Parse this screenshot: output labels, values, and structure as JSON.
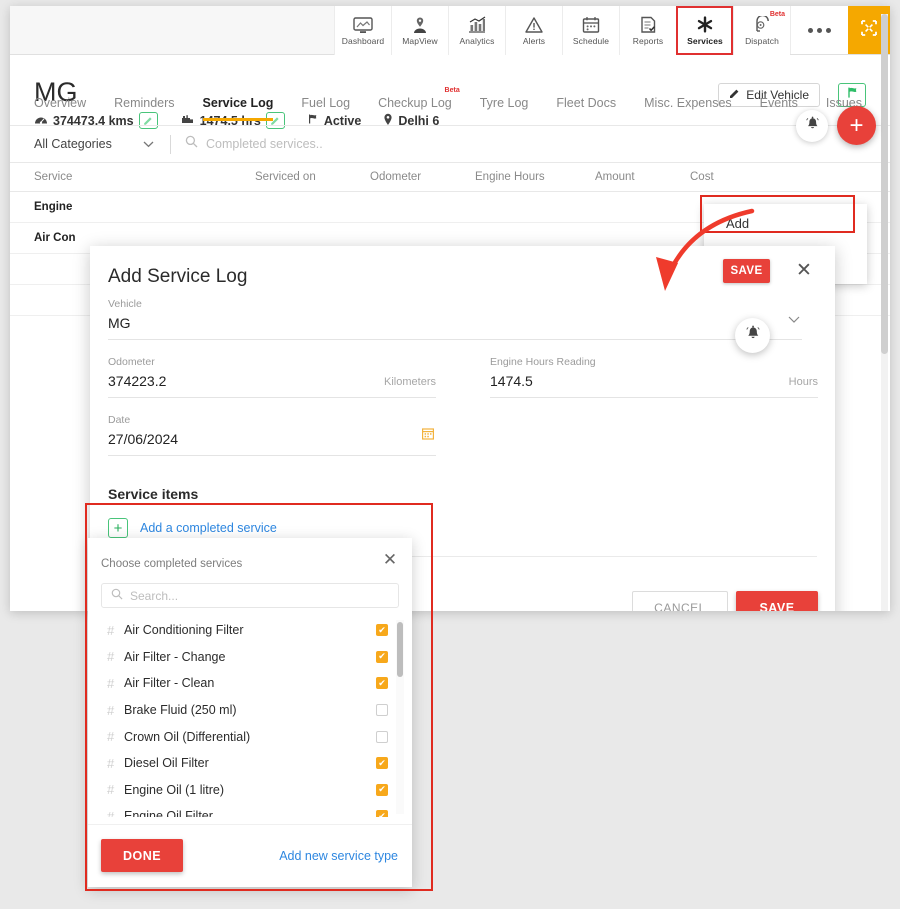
{
  "topnav": {
    "items": [
      {
        "label": "Dashboard",
        "icon": "dashboard-icon",
        "beta": "",
        "active": false
      },
      {
        "label": "MapView",
        "icon": "mapview-icon",
        "beta": "",
        "active": false
      },
      {
        "label": "Analytics",
        "icon": "analytics-icon",
        "beta": "",
        "active": false
      },
      {
        "label": "Alerts",
        "icon": "alerts-icon",
        "beta": "",
        "active": false
      },
      {
        "label": "Schedule",
        "icon": "schedule-icon",
        "beta": "",
        "active": false
      },
      {
        "label": "Reports",
        "icon": "reports-icon",
        "beta": "",
        "active": false
      },
      {
        "label": "Services",
        "icon": "services-icon",
        "beta": "",
        "active": true
      },
      {
        "label": "Dispatch",
        "icon": "dispatch-icon",
        "beta": "Beta",
        "active": false
      }
    ],
    "more_icon": "more-dots-icon",
    "collapse_icon": "collapse-fullscreen-icon"
  },
  "vehicle": {
    "name": "MG",
    "odometer": "374473.4 kms",
    "engine_hours": "1474.5 hrs",
    "status": "Active",
    "location": "Delhi 6",
    "edit_button": "Edit Vehicle",
    "flag_icon": "green-flag-icon"
  },
  "tabs": [
    {
      "label": "Overview",
      "active": false,
      "beta": ""
    },
    {
      "label": "Reminders",
      "active": false,
      "beta": ""
    },
    {
      "label": "Service Log",
      "active": true,
      "beta": ""
    },
    {
      "label": "Fuel Log",
      "active": false,
      "beta": ""
    },
    {
      "label": "Checkup Log",
      "active": false,
      "beta": "Beta"
    },
    {
      "label": "Tyre Log",
      "active": false,
      "beta": ""
    },
    {
      "label": "Fleet Docs",
      "active": false,
      "beta": ""
    },
    {
      "label": "Misc. Expenses",
      "active": false,
      "beta": ""
    },
    {
      "label": "Events",
      "active": false,
      "beta": ""
    },
    {
      "label": "Issues",
      "active": false,
      "beta": ""
    }
  ],
  "filterbar": {
    "category_value": "All Categories",
    "search_placeholder": "Completed services.."
  },
  "table": {
    "columns": [
      "Service",
      "Serviced on",
      "Odometer",
      "Engine Hours",
      "Amount",
      "Cost"
    ],
    "rows": [
      {
        "service": "Engine "
      },
      {
        "service": "Air Con"
      }
    ]
  },
  "fab": {
    "bell_icon": "bell-icon",
    "add_icon": "plus-icon"
  },
  "add_menu": {
    "items": [
      "Add"
    ]
  },
  "modal": {
    "title": "Add Service Log",
    "save_label": "SAVE",
    "close_icon": "close-icon",
    "vehicle_label": "Vehicle",
    "vehicle_value": "MG",
    "odometer_label": "Odometer",
    "odometer_value": "374223.2",
    "odometer_unit": "Kilometers",
    "engine_hours_label": "Engine Hours Reading",
    "engine_hours_value": "1474.5",
    "engine_hours_unit": "Hours",
    "date_label": "Date",
    "date_value": "27/06/2024",
    "calendar_icon": "calendar-icon",
    "service_items_label": "Service items",
    "add_service_link": "Add a completed service",
    "cancel_label": "CANCEL",
    "footer_save_label": "SAVE"
  },
  "chooser": {
    "title": "Choose completed services",
    "close_icon": "close-icon",
    "search_placeholder": "Search...",
    "items": [
      {
        "name": "Air Conditioning Filter",
        "checked": true
      },
      {
        "name": "Air Filter - Change",
        "checked": true
      },
      {
        "name": "Air Filter - Clean",
        "checked": true
      },
      {
        "name": "Brake Fluid (250 ml)",
        "checked": false
      },
      {
        "name": "Crown Oil (Differential)",
        "checked": false
      },
      {
        "name": "Diesel Oil Filter",
        "checked": true
      },
      {
        "name": "Engine Oil (1 litre)",
        "checked": true
      },
      {
        "name": "Engine Oil Filter",
        "checked": true
      }
    ],
    "done_label": "DONE",
    "add_new_link": "Add new service type"
  },
  "colors": {
    "accent_red": "#e8413a",
    "annotation_red": "#e02b20",
    "brand_yellow": "#f5a800",
    "link_blue": "#2e87e0",
    "check_orange": "#f7a81b",
    "green": "#49c47a"
  }
}
